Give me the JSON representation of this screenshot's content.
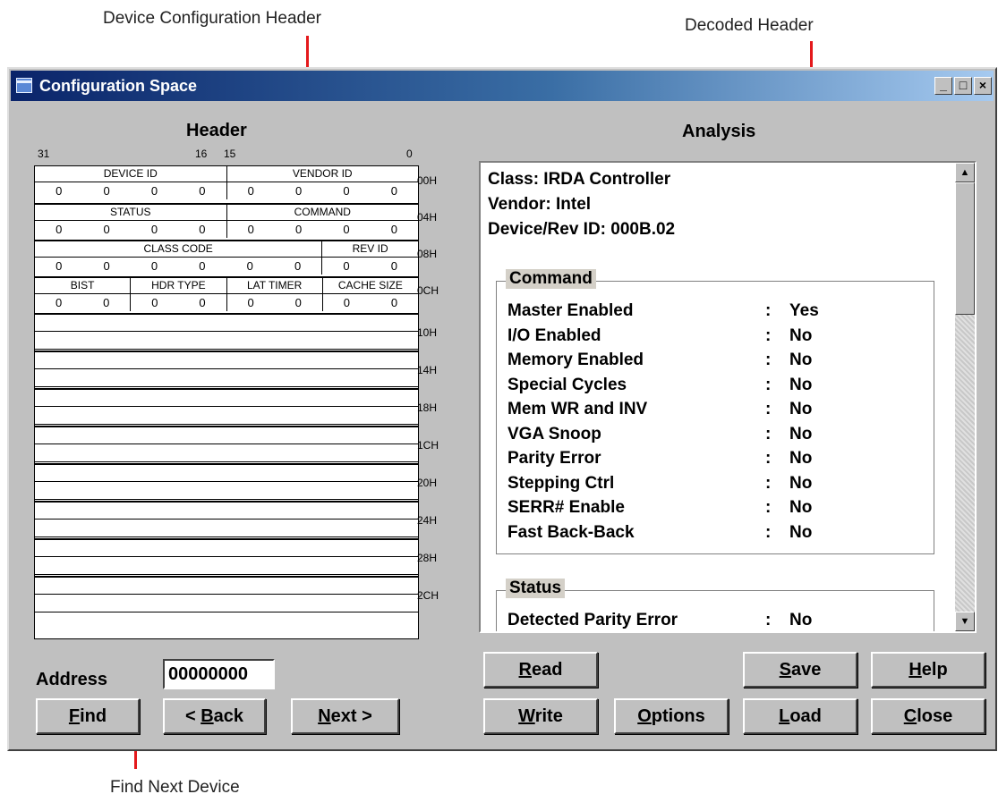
{
  "callouts": {
    "device_header": "Device Configuration Header",
    "decoded_header": "Decoded Header",
    "find_next": "Find Next Device"
  },
  "window": {
    "title": "Configuration Space",
    "controls": {
      "minimize": "_",
      "maximize": "□",
      "close": "×"
    }
  },
  "header_panel": {
    "title": "Header",
    "bit_labels": [
      "31",
      "16",
      "15",
      "0"
    ],
    "registers": [
      {
        "offset": "00H",
        "fields": [
          "DEVICE ID",
          "VENDOR ID"
        ],
        "values": [
          "0",
          "0",
          "0",
          "0",
          "0",
          "0",
          "0",
          "0"
        ]
      },
      {
        "offset": "04H",
        "fields": [
          "STATUS",
          "COMMAND"
        ],
        "values": [
          "0",
          "0",
          "0",
          "0",
          "0",
          "0",
          "0",
          "0"
        ]
      },
      {
        "offset": "08H",
        "fields": [
          "CLASS CODE",
          "REV ID"
        ],
        "values": [
          "0",
          "0",
          "0",
          "0",
          "0",
          "0",
          "0",
          "0"
        ]
      },
      {
        "offset": "0CH",
        "fields": [
          "BIST",
          "HDR TYPE",
          "LAT TIMER",
          "CACHE SIZE"
        ],
        "values": [
          "0",
          "0",
          "0",
          "0",
          "0",
          "0",
          "0",
          "0"
        ]
      }
    ],
    "empty_offsets": [
      "10H",
      "14H",
      "18H",
      "1CH",
      "20H",
      "24H",
      "28H",
      "2CH"
    ]
  },
  "analysis": {
    "title": "Analysis",
    "class_line": "Class: IRDA Controller",
    "vendor_line": "Vendor: Intel",
    "device_line": "Device/Rev ID: 000B.02",
    "command_group": {
      "label": "Command",
      "rows": [
        {
          "name": "Master Enabled",
          "value": "Yes"
        },
        {
          "name": "I/O Enabled",
          "value": "No"
        },
        {
          "name": "Memory Enabled",
          "value": "No"
        },
        {
          "name": "Special Cycles",
          "value": "No"
        },
        {
          "name": "Mem WR and INV",
          "value": "No"
        },
        {
          "name": "VGA Snoop",
          "value": "No"
        },
        {
          "name": "Parity Error",
          "value": "No"
        },
        {
          "name": "Stepping Ctrl",
          "value": "No"
        },
        {
          "name": "SERR# Enable",
          "value": "No"
        },
        {
          "name": "Fast Back-Back",
          "value": "No"
        }
      ]
    },
    "status_group": {
      "label": "Status",
      "rows": [
        {
          "name": "Detected Parity Error",
          "value": "No"
        }
      ]
    },
    "colon": ":"
  },
  "address": {
    "label": "Address",
    "value": "00000000"
  },
  "buttons": {
    "find": {
      "pre": "",
      "key": "F",
      "post": "ind"
    },
    "back": {
      "pre": "< ",
      "key": "B",
      "post": "ack"
    },
    "next": {
      "pre": "",
      "key": "N",
      "post": "ext >"
    },
    "read": {
      "pre": "",
      "key": "R",
      "post": "ead"
    },
    "write": {
      "pre": "",
      "key": "W",
      "post": "rite"
    },
    "options": {
      "pre": "",
      "key": "O",
      "post": "ptions"
    },
    "save": {
      "pre": "",
      "key": "S",
      "post": "ave"
    },
    "load": {
      "pre": "",
      "key": "L",
      "post": "oad"
    },
    "help": {
      "pre": "",
      "key": "H",
      "post": "elp"
    },
    "close": {
      "pre": "",
      "key": "C",
      "post": "lose"
    }
  },
  "colors": {
    "callout_line": "#e4191c",
    "window_face": "#c0c0c0",
    "title_gradient_start": "#0a246a",
    "title_gradient_end": "#a6caf0",
    "groupbox_label_bg": "#d4d0c8"
  }
}
